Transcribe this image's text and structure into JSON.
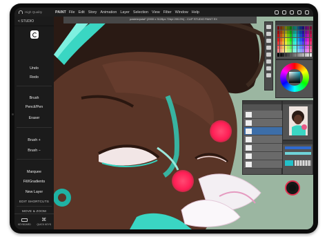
{
  "status": {
    "quality_label": "High Quality"
  },
  "menubar": {
    "app_name": "PAINT",
    "items": [
      "File",
      "Edit",
      "Story",
      "Animation",
      "Layer",
      "Selection",
      "View",
      "Filter",
      "Window",
      "Help"
    ]
  },
  "sidebar": {
    "back_label": "< STUDIO",
    "items": [
      "Undo",
      "Redo",
      "Brush",
      "Pencil/Pen",
      "Eraser",
      "Brush +",
      "Brush −",
      "Marquee",
      "Fill/Gradients",
      "New Layer"
    ],
    "section_label": "EDIT SHORTCUTS",
    "move_zoom_label": "MOVE & ZOOM",
    "bottom": {
      "keyboard_label": "KEYBOARD",
      "quick_keys_label": "QUICK KEYS"
    }
  },
  "canvas": {
    "document_title": "pastelcrystal* (2000 x 3128px 72dpi 200.0%) - CLIP STUDIO PAINT EX"
  },
  "colors": {
    "accent_touch": "#ff2d5e",
    "skin": "#5a3527",
    "teal": "#3dd6c4",
    "background_green": "#9ab59f"
  }
}
